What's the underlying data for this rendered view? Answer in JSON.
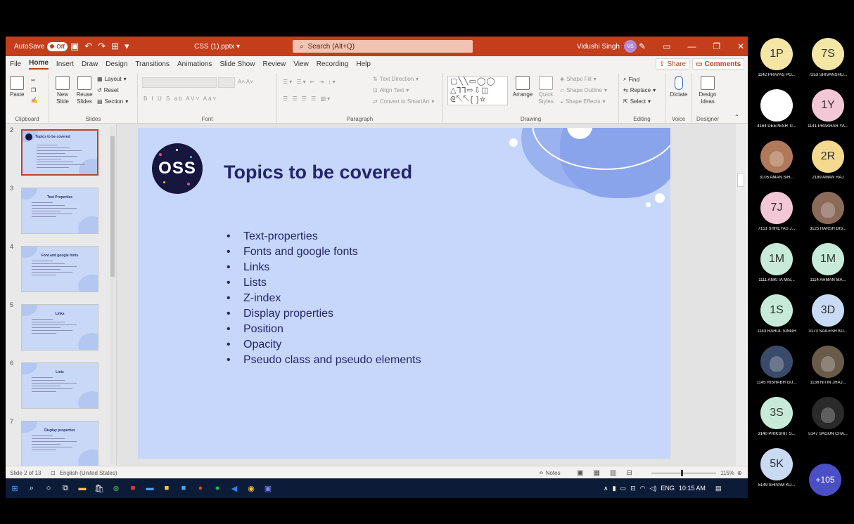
{
  "app": {
    "autosave_label": "AutoSave",
    "autosave_state": "Off",
    "file_name": "CSS (1).pptx",
    "search_placeholder": "Search (Alt+Q)",
    "user_name": "Vidushi Singh",
    "user_initials": "VS"
  },
  "menu": {
    "tabs": [
      "File",
      "Home",
      "Insert",
      "Draw",
      "Design",
      "Transitions",
      "Animations",
      "Slide Show",
      "Review",
      "View",
      "Recording",
      "Help"
    ],
    "share": "Share",
    "comments": "Comments"
  },
  "ribbon": {
    "clipboard": {
      "paste": "Paste",
      "label": "Clipboard"
    },
    "slides": {
      "new_slide": "New Slide",
      "reuse_slides": "Reuse Slides",
      "layout": "Layout",
      "reset": "Reset",
      "section": "Section",
      "label": "Slides"
    },
    "font": {
      "label": "Font",
      "size_arrows": "A˄ A˅",
      "styles": "B  I  U  S  ab  AV˅  Aa˅"
    },
    "paragraph": {
      "text_direction": "Text Direction",
      "align_text": "Align Text",
      "convert_smartart": "Convert to SmartArt",
      "label": "Paragraph"
    },
    "drawing": {
      "arrange": "Arrange",
      "quick_styles": "Quick Styles",
      "shape_fill": "Shape Fill",
      "shape_outline": "Shape Outline",
      "shape_effects": "Shape Effects",
      "label": "Drawing"
    },
    "editing": {
      "find": "Find",
      "replace": "Replace",
      "select": "Select",
      "label": "Editing"
    },
    "voice": {
      "dictate": "Dictate",
      "label": "Voice"
    },
    "designer": {
      "design_ideas": "Design Ideas",
      "label": "Designer"
    }
  },
  "thumbnails": [
    {
      "num": "2",
      "title": "Topics to be covered",
      "selected": true
    },
    {
      "num": "3",
      "title": "Text Properties"
    },
    {
      "num": "4",
      "title": "Font and google fonts"
    },
    {
      "num": "5",
      "title": "Links"
    },
    {
      "num": "6",
      "title": "Lists"
    },
    {
      "num": "7",
      "title": "Display properties"
    }
  ],
  "slide": {
    "logo_text": "OSS",
    "title": "Topics to be covered",
    "bullets": [
      "Text-properties",
      "Fonts and google fonts",
      "Links",
      "Lists",
      "Z-index",
      "Display properties",
      "Position",
      "Opacity",
      "Pseudo class and pseudo elements"
    ]
  },
  "status": {
    "slide_count": "Slide 2 of 13",
    "language": "English (United States)",
    "notes": "Notes",
    "zoom": "115%"
  },
  "taskbar": {
    "lang": "ENG",
    "time": "10:15 AM"
  },
  "participants": [
    {
      "initials": "1P",
      "name": "1142  PRAYAS PO...",
      "color": "#f6e6a5"
    },
    {
      "initials": "7S",
      "name": "7253  SHIVANSHU...",
      "color": "#f4e6a4"
    },
    {
      "initials": "",
      "name": "4164  DEEPESH TI...",
      "color": "#ffffff",
      "photo": "glasses-avatar"
    },
    {
      "initials": "1Y",
      "name": "1141  PRAKHAR YA...",
      "color": "#f3c7d6"
    },
    {
      "initials": "",
      "name": "3105   AMAN SIH...",
      "color": "#b07a5a",
      "photo": "baby-photo"
    },
    {
      "initials": "2R",
      "name": "2189 AMAN RAJ",
      "color": "#f5d98e"
    },
    {
      "initials": "7J",
      "name": "7151  SHREYAS J...",
      "color": "#f3c7d6"
    },
    {
      "initials": "",
      "name": "3125  HARSH BIS...",
      "color": "#8b6a5a",
      "photo": "person-photo"
    },
    {
      "initials": "1M",
      "name": "1111  ANKITA MIS...",
      "color": "#c7ebd8"
    },
    {
      "initials": "1M",
      "name": "1114  ARMAN MA...",
      "color": "#c7ebd8"
    },
    {
      "initials": "1S",
      "name": "1143 RAHUL SINGH",
      "color": "#c7ebd8"
    },
    {
      "initials": "3D",
      "name": "3173  SAILESH KU...",
      "color": "#c9dbf4"
    },
    {
      "initials": "",
      "name": "1145  RISHABH GU...",
      "color": "#3a4a6a",
      "photo": "anime-avatar"
    },
    {
      "initials": "",
      "name": "1136  NITIN JHAJ...",
      "color": "#6a5a4a",
      "photo": "person-photo"
    },
    {
      "initials": "3S",
      "name": "3140  PRIKSHIT S...",
      "color": "#c7ebd8"
    },
    {
      "initials": "",
      "name": "5147  SAGUN CHA...",
      "color": "#2a2a2a",
      "photo": "dark-photo"
    },
    {
      "initials": "5K",
      "name": "5149  SHIVAM KU...",
      "color": "#c9dbf4"
    }
  ],
  "more_participants": "+105"
}
